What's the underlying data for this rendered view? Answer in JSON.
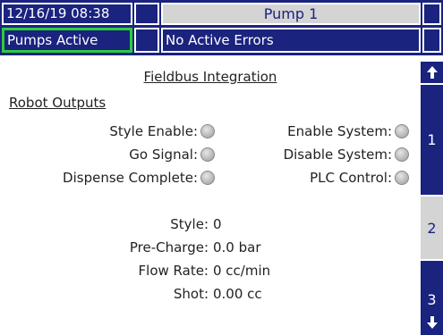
{
  "header": {
    "datetime": "12/16/19 08:38",
    "title": "Pump 1",
    "pumps_status": "Pumps Active",
    "error_status": "No Active Errors"
  },
  "main": {
    "title": "Fieldbus Integration",
    "section": "Robot Outputs",
    "outputs_left": [
      {
        "label": "Style Enable:"
      },
      {
        "label": "Go Signal:"
      },
      {
        "label": "Dispense Complete:"
      }
    ],
    "outputs_right": [
      {
        "label": "Enable System:"
      },
      {
        "label": "Disable System:"
      },
      {
        "label": "PLC Control:"
      }
    ],
    "values": [
      {
        "label": "Style:",
        "value": "0"
      },
      {
        "label": "Pre-Charge:",
        "value": "0.0 bar"
      },
      {
        "label": "Flow Rate:",
        "value": "0 cc/min"
      },
      {
        "label": "Shot:",
        "value": "0.00 cc"
      }
    ]
  },
  "tabs": [
    {
      "label": "1",
      "active": false
    },
    {
      "label": "2",
      "active": true
    },
    {
      "label": "3",
      "active": false
    }
  ],
  "icons": {
    "scroll_up": "arrow-up-icon",
    "scroll_down": "arrow-down-icon"
  },
  "colors": {
    "header_blue": "#1a237e",
    "active_green": "#2ecc40",
    "selected_grey": "#d4d4d4"
  }
}
